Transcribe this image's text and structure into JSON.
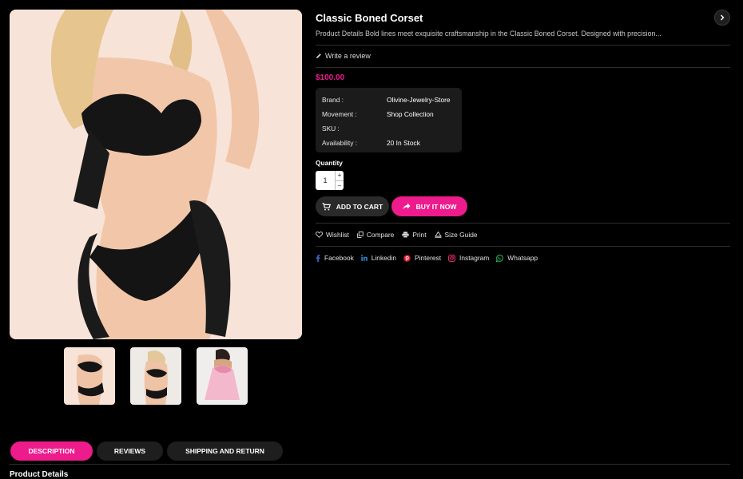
{
  "product": {
    "title": "Classic Boned Corset",
    "description": "Product Details Bold lines meet exquisite craftsmanship in the Classic Boned Corset. Designed with precision...",
    "review_link": "Write a review",
    "price": "$100.00"
  },
  "specs": [
    {
      "label": "Brand :",
      "value": "Olivine-Jewelry-Store"
    },
    {
      "label": "Movement :",
      "value": "Shop Collection"
    },
    {
      "label": "SKU :",
      "value": ""
    },
    {
      "label": "Availability :",
      "value": "20 In Stock"
    }
  ],
  "quantity": {
    "label": "Quantity",
    "value": "1",
    "plus": "+",
    "minus": "–"
  },
  "buttons": {
    "add_to_cart": "ADD TO CART",
    "buy_now": "BUY IT NOW"
  },
  "tools": [
    {
      "label": "Wishlist",
      "icon": "heart-icon"
    },
    {
      "label": "Compare",
      "icon": "compare-icon"
    },
    {
      "label": "Print",
      "icon": "printer-icon"
    },
    {
      "label": "Size Guide",
      "icon": "ruler-icon"
    }
  ],
  "socials": [
    {
      "label": "Facebook",
      "icon": "facebook-icon",
      "color": "#3b6fd1"
    },
    {
      "label": "Linkedin",
      "icon": "linkedin-icon",
      "color": "#2a8fd8"
    },
    {
      "label": "Pinterest",
      "icon": "pinterest-icon",
      "color": "#e02030"
    },
    {
      "label": "Instagram",
      "icon": "instagram-icon",
      "color": "#e0306a"
    },
    {
      "label": "Whatsapp",
      "icon": "whatsapp-icon",
      "color": "#2fc25b"
    }
  ],
  "tabs": [
    {
      "label": "DESCRIPTION",
      "active": true
    },
    {
      "label": "REVIEWS",
      "active": false
    },
    {
      "label": "SHIPPING AND RETURN",
      "active": false
    }
  ],
  "section_heading": "Product Details",
  "colors": {
    "accent": "#ee1b8c",
    "background": "#000000",
    "panel": "#1b1b1b"
  }
}
